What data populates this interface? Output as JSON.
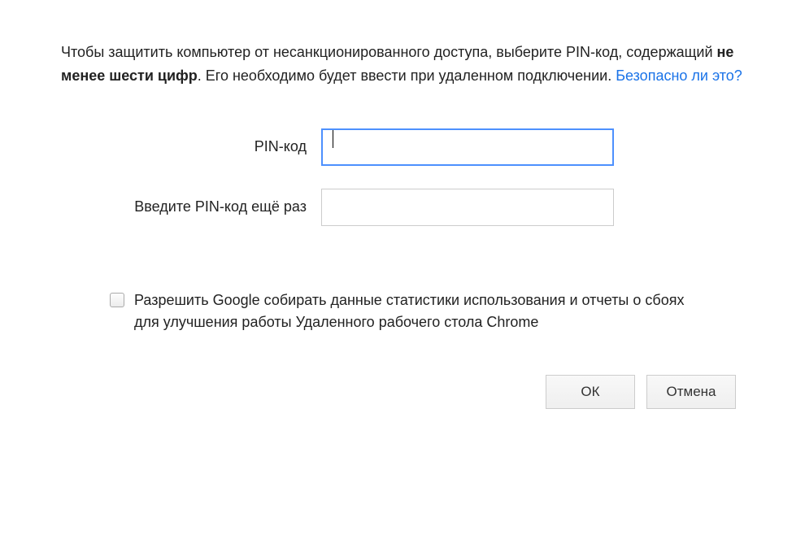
{
  "instruction": {
    "part1": "Чтобы защитить компьютер от несанкционированного доступа, выберите PIN-код, содержащий ",
    "bold": "не менее шести цифр",
    "part2": ". Его необходимо будет ввести при удаленном подключении. ",
    "link": "Безопасно ли это?"
  },
  "form": {
    "pin_label": "PIN-код",
    "pin_value": "",
    "pin_confirm_label": "Введите PIN-код ещё раз",
    "pin_confirm_value": ""
  },
  "checkbox": {
    "label": "Разрешить Google собирать данные статистики использования и отчеты о сбоях для улучшения работы Удаленного рабочего стола Chrome",
    "checked": false
  },
  "buttons": {
    "ok": "ОК",
    "cancel": "Отмена"
  }
}
